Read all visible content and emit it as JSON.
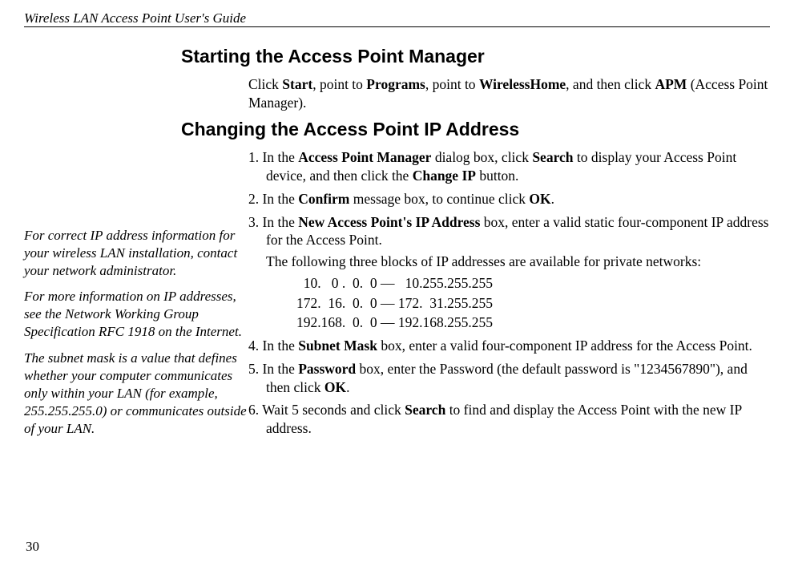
{
  "header": "Wireless LAN Access Point User's Guide",
  "page_number": "30",
  "section1_title": "Starting the Access Point Manager",
  "section1_para_pre": "Click ",
  "section1_start": "Start",
  "section1_mid1": ", point to ",
  "section1_programs": "Programs",
  "section1_mid2": ", point to ",
  "section1_wirelesshome": "WirelessHome",
  "section1_mid3": ", and then click ",
  "section1_apm": "APM",
  "section1_end": " (Access Point Manager).",
  "section2_title": "Changing the Access Point IP Address",
  "step1_pre": "1. In the ",
  "step1_bold1": "Access Point Manager",
  "step1_mid1": " dialog box, click ",
  "step1_bold2": "Search",
  "step1_mid2": " to display your Access Point device, and then click the ",
  "step1_bold3": "Change IP",
  "step1_end": " button.",
  "step2_pre": "2. In the ",
  "step2_bold1": "Confirm",
  "step2_mid1": " message box, to continue click ",
  "step2_bold2": "OK",
  "step2_end": ".",
  "step3_pre": "3. In the ",
  "step3_bold1": "New Access Point's IP Address",
  "step3_end": " box, enter a valid static four-component IP address for the Access Point.",
  "step3_sub": "The following three blocks of IP addresses are available for private networks:",
  "ip_range1": "  10.   0 .  0.  0 —   10.255.255.255",
  "ip_range2": "172.  16.  0.  0 — 172.  31.255.255",
  "ip_range3": "192.168.  0.  0 — 192.168.255.255",
  "step4_pre": "4. In the ",
  "step4_bold1": "Subnet Mask",
  "step4_end": " box, enter a valid four-component IP address for the Access Point.",
  "step5_pre": "5. In the ",
  "step5_bold1": "Password",
  "step5_mid1": " box, enter the Password (the default password is \"1234567890\"), and then click ",
  "step5_bold2": "OK",
  "step5_end": ".",
  "step6_pre": "6. Wait 5 seconds and click ",
  "step6_bold1": "Search",
  "step6_end": " to find and display the Access Point with the new IP address.",
  "sidebar1": "For correct IP address information for your wireless LAN installation, contact your network administrator.",
  "sidebar2": "For more information on IP addresses, see the Network Working Group Specification RFC 1918 on the Internet.",
  "sidebar3": "The subnet mask is a value that defines whether your computer communicates only within your LAN (for example, 255.255.255.0) or communicates outside of your LAN."
}
